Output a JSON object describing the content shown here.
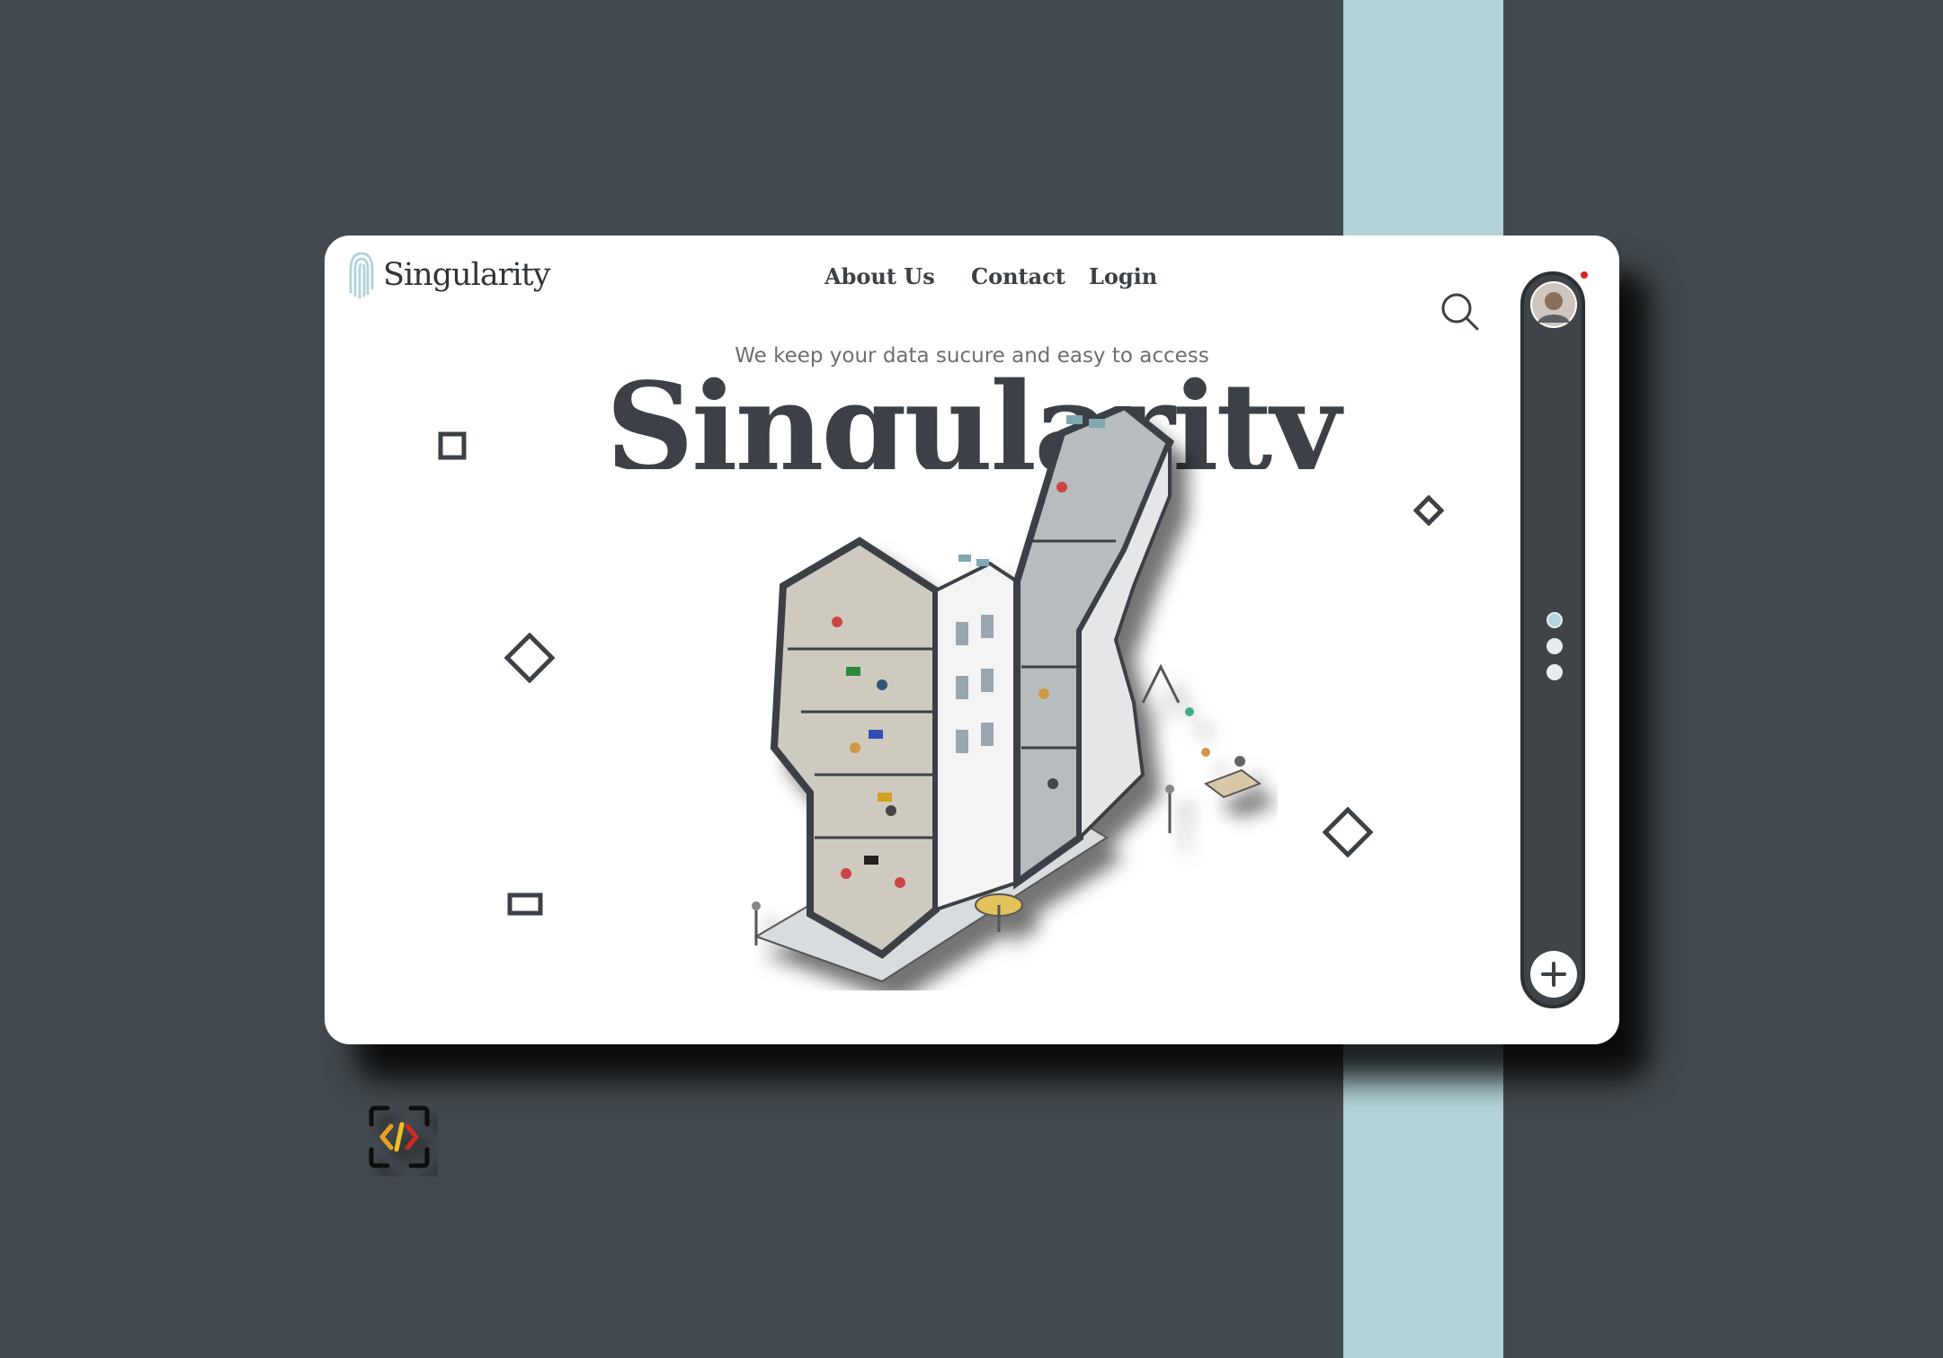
{
  "colors": {
    "background": "#434a4f",
    "accent_stripe": "#b4d3d9",
    "card": "#ffffff",
    "sidebar": "#3e4448",
    "text_dark": "#3b4146",
    "notification": "#e02424"
  },
  "brand": {
    "name": "Singularity",
    "icon": "fingerprint-icon"
  },
  "nav": {
    "about": "About Us",
    "contact": "Contact",
    "login": "Login"
  },
  "hero": {
    "tagline": "We keep your data sucure and easy to access",
    "title": "Singularity"
  },
  "sidebar": {
    "avatar": "user-avatar",
    "notification_icon": "notification-dot",
    "pager": {
      "count": 3,
      "active": 1
    },
    "add_icon": "plus-icon"
  },
  "icons": {
    "search": "search-icon",
    "dev_logo": "code-brackets-icon"
  }
}
